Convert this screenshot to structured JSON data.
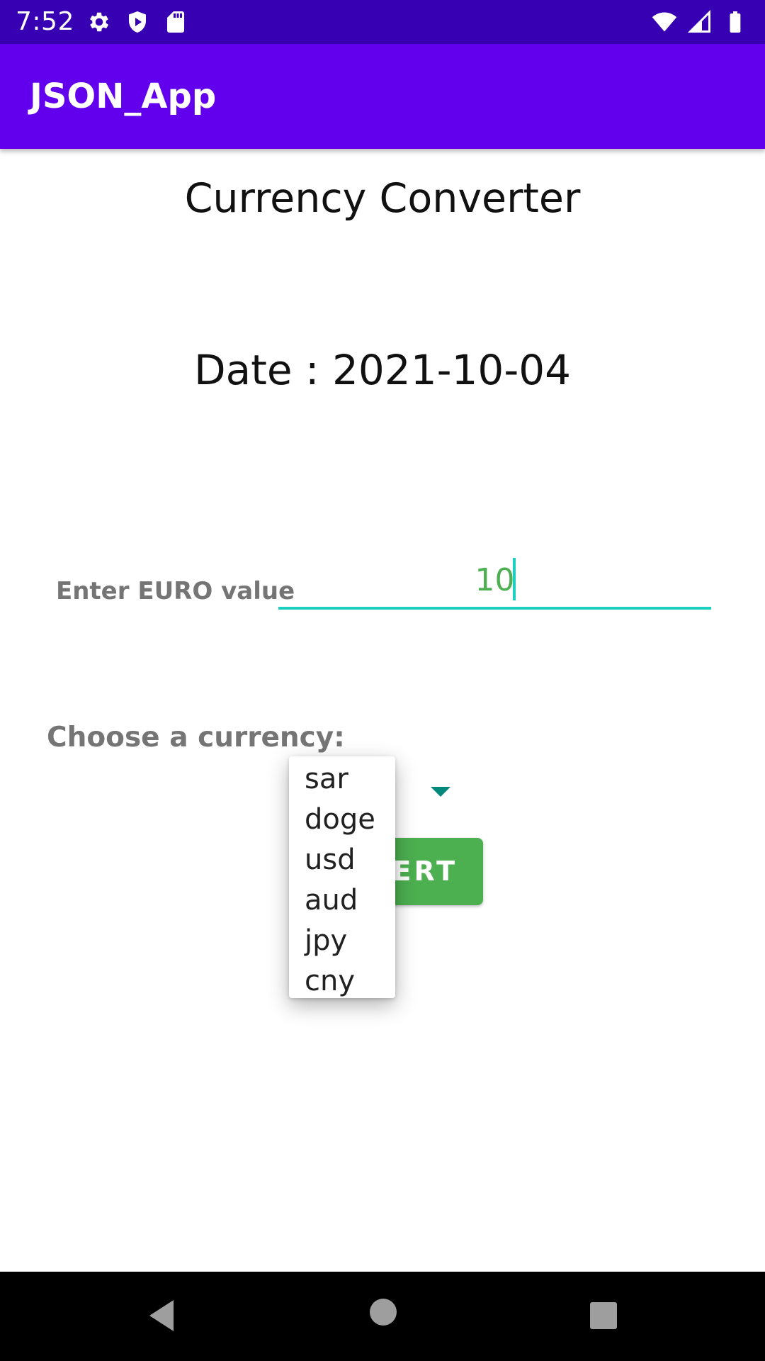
{
  "status_bar": {
    "time": "7:52",
    "left_icons": [
      "settings-icon",
      "shield-icon",
      "sd-card-icon"
    ],
    "right_icons": [
      "wifi-icon",
      "cell-signal-icon",
      "battery-icon"
    ]
  },
  "app_bar": {
    "title": "JSON_App",
    "color": "#6200ee"
  },
  "main": {
    "title": "Currency Converter",
    "date_label": "Date : ",
    "date_value": "2021-10-04",
    "euro_label": "Enter EURO value",
    "euro_value": "10",
    "currency_label": "Choose a currency:",
    "convert_label": "CONVERT",
    "convert_color": "#4caf50",
    "accent_color": "#1ccfc0"
  },
  "dropdown": {
    "options": [
      "sar",
      "doge",
      "usd",
      "aud",
      "jpy",
      "cny"
    ]
  },
  "nav_bar": {
    "buttons": [
      "back-icon",
      "home-icon",
      "recents-icon"
    ]
  }
}
